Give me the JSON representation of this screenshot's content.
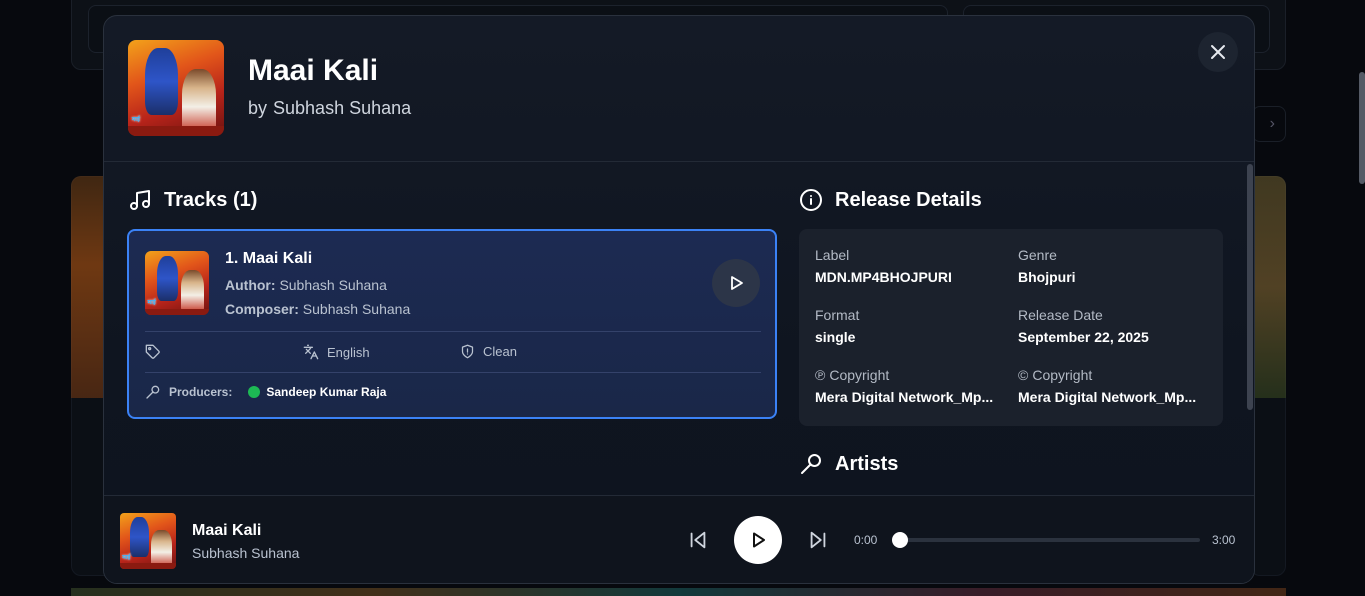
{
  "modal": {
    "title": "Maai Kali",
    "artist_prefix": "by",
    "artist": "Subhash Suhana"
  },
  "tracks": {
    "heading": "Tracks (1)",
    "items": [
      {
        "name": "1. Maai Kali",
        "author_label": "Author:",
        "author": "Subhash Suhana",
        "composer_label": "Composer:",
        "composer": "Subhash Suhana",
        "language": "English",
        "explicit": "Clean",
        "producers_label": "Producers:",
        "producer": "Sandeep Kumar Raja"
      }
    ]
  },
  "release": {
    "heading": "Release Details",
    "label_label": "Label",
    "label": "MDN.MP4BHOJPURI",
    "genre_label": "Genre",
    "genre": "Bhojpuri",
    "format_label": "Format",
    "format": "single",
    "date_label": "Release Date",
    "date": "September 22, 2025",
    "p_copyright_label": "Copyright",
    "p_copyright": "Mera Digital Network_Mp...",
    "c_copyright_label": "Copyright",
    "c_copyright": "Mera Digital Network_Mp..."
  },
  "artists": {
    "heading": "Artists"
  },
  "player": {
    "title": "Maai Kali",
    "artist": "Subhash Suhana",
    "time_current": "0:00",
    "time_total": "3:00",
    "progress": 0.0
  },
  "colors": {
    "accent": "#3b82f6",
    "track_card_bg": "#1c2a52",
    "spotify": "#1db954"
  }
}
